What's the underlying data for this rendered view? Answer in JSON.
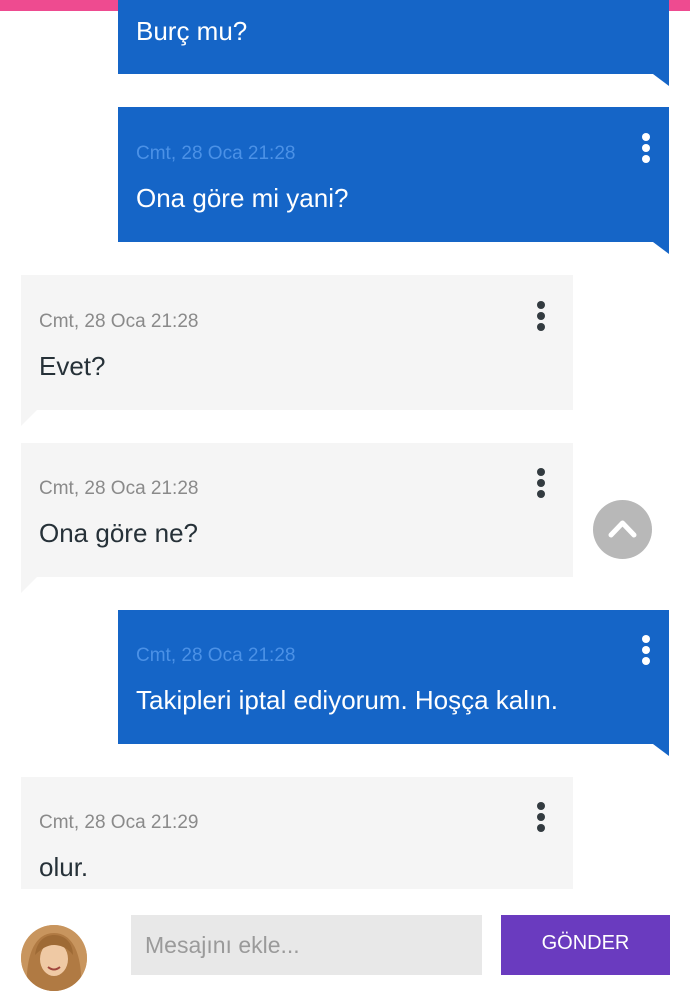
{
  "messages": [
    {
      "type": "sent",
      "time": "",
      "text": "Burç mu?"
    },
    {
      "type": "sent",
      "time": "Cmt, 28 Oca 21:28",
      "text": "Ona göre mi yani?"
    },
    {
      "type": "received",
      "time": "Cmt, 28 Oca 21:28",
      "text": "Evet?"
    },
    {
      "type": "received",
      "time": "Cmt, 28 Oca 21:28",
      "text": "Ona göre ne?"
    },
    {
      "type": "sent",
      "time": "Cmt, 28 Oca 21:28",
      "text": "Takipleri iptal ediyorum. Hoşça kalın."
    },
    {
      "type": "received",
      "time": "Cmt, 28 Oca 21:29",
      "text": "olur."
    }
  ],
  "composer": {
    "placeholder": "Mesajını ekle...",
    "send_label": "GÖNDER"
  },
  "colors": {
    "top_bar": "#ee4b90",
    "sent_bubble": "#1565c7",
    "received_bubble": "#f5f5f5",
    "send_button": "#6a3bbf"
  },
  "icons": {
    "message_menu": "kebab-menu-icon",
    "scroll_top": "chevron-up-icon"
  }
}
